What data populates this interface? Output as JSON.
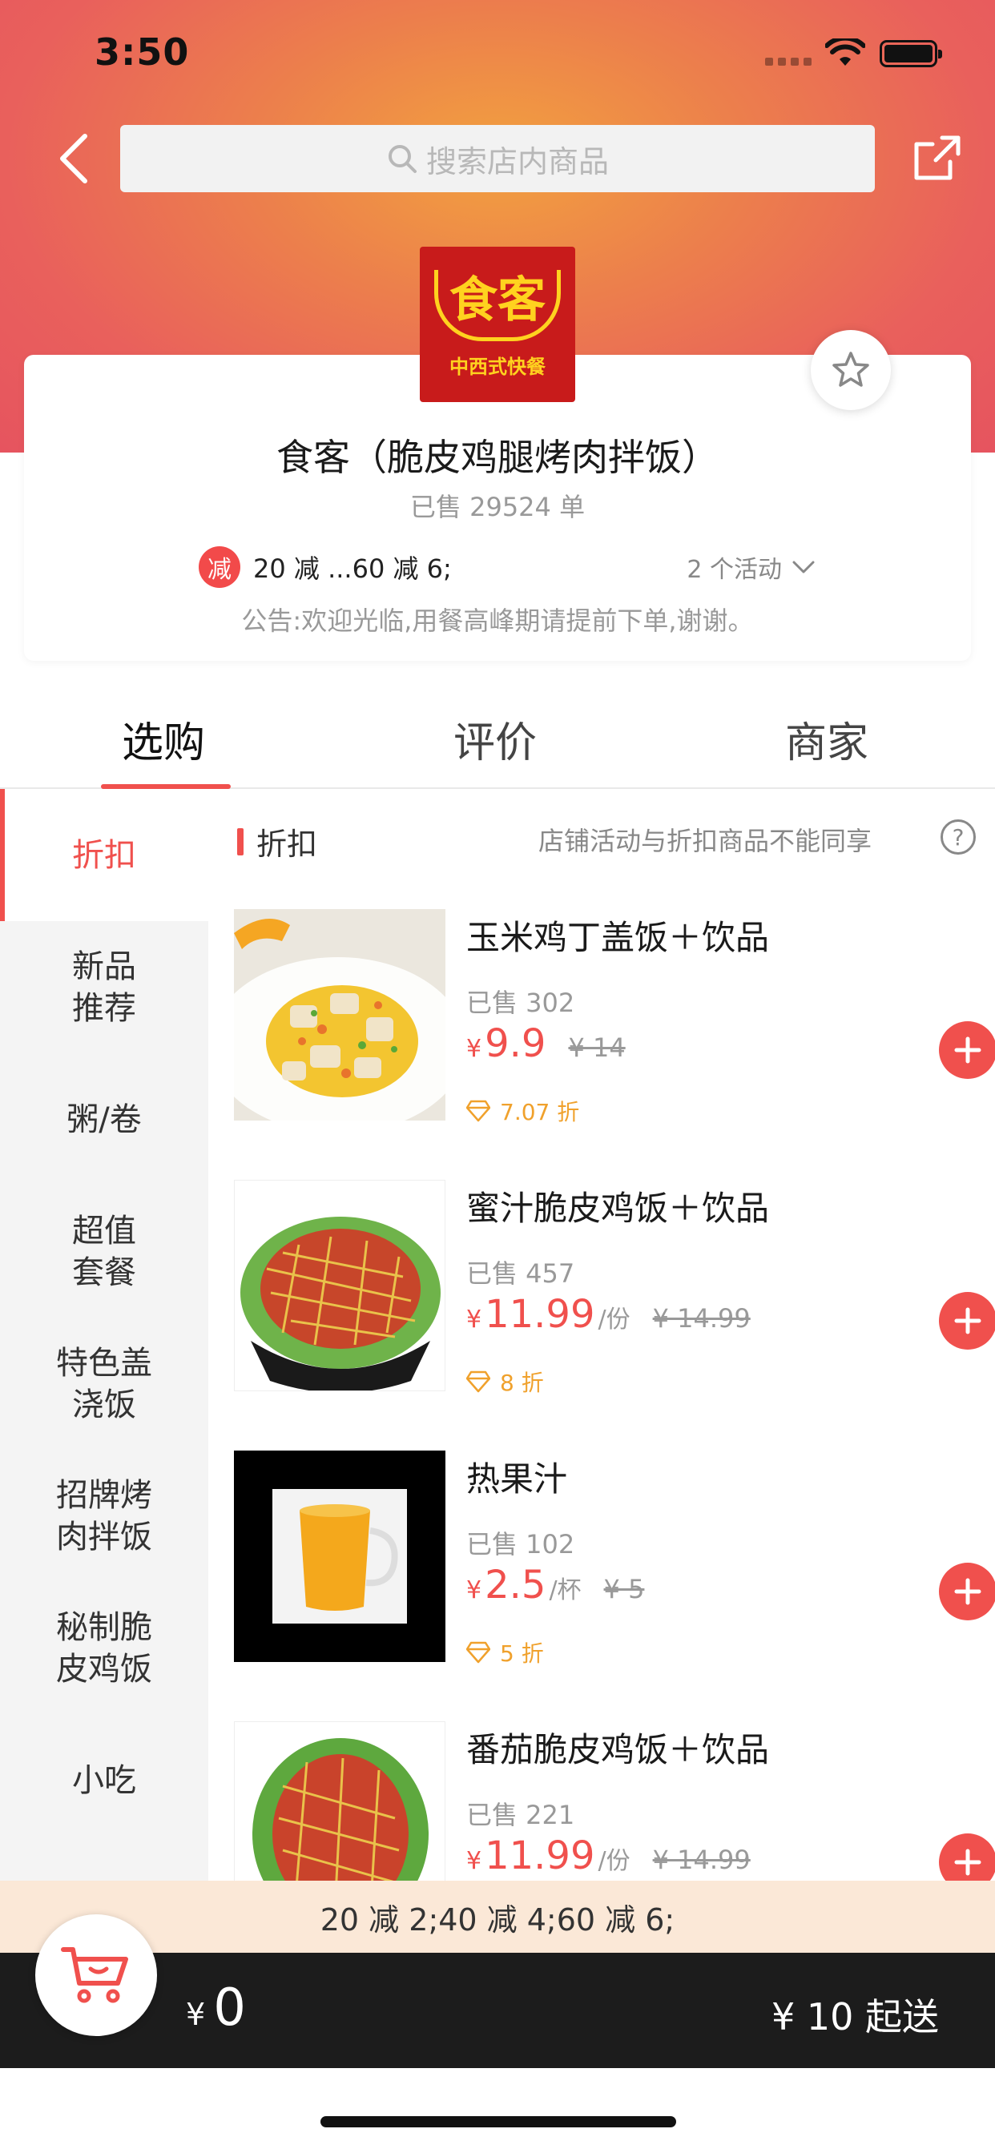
{
  "status_bar": {
    "time": "3:50"
  },
  "nav": {
    "search_placeholder": "搜索店内商品"
  },
  "shop": {
    "logo_text": "食客",
    "logo_sub": "中西式快餐",
    "name": "食客（脆皮鸡腿烤肉拌饭）",
    "sold_total": "已售 29524 单",
    "promo_badge": "减",
    "promo_text": "20 减 ...60 减 6;",
    "promo_count": "2 个活动",
    "notice": "公告:欢迎光临,用餐高峰期请提前下单,谢谢。"
  },
  "tabs": [
    {
      "label": "选购",
      "active": true
    },
    {
      "label": "评价",
      "active": false
    },
    {
      "label": "商家",
      "active": false
    }
  ],
  "sidebar": {
    "items": [
      {
        "label": "折扣",
        "active": true
      },
      {
        "label": "新品\n推荐"
      },
      {
        "label": "粥/卷"
      },
      {
        "label": "超值\n套餐"
      },
      {
        "label": "特色盖\n浇饭"
      },
      {
        "label": "招牌烤\n肉拌饭"
      },
      {
        "label": "秘制脆\n皮鸡饭"
      },
      {
        "label": "小吃"
      }
    ]
  },
  "section": {
    "title": "折扣",
    "note": "店铺活动与折扣商品不能同享",
    "help": "?"
  },
  "products": [
    {
      "name": "玉米鸡丁盖饭＋饮品",
      "sold": "已售 302",
      "currency": "¥",
      "price": "9.9",
      "unit": "",
      "original": "¥ 14",
      "discount": "7.07 折"
    },
    {
      "name": "蜜汁脆皮鸡饭＋饮品",
      "sold": "已售 457",
      "currency": "¥",
      "price": "11.99",
      "unit": "/份",
      "original": "¥ 14.99",
      "discount": "8 折"
    },
    {
      "name": "热果汁",
      "sold": "已售 102",
      "currency": "¥",
      "price": "2.5",
      "unit": "/杯",
      "original": "¥ 5",
      "discount": "5 折"
    },
    {
      "name": "番茄脆皮鸡饭＋饮品",
      "sold": "已售 221",
      "currency": "¥",
      "price": "11.99",
      "unit": "/份",
      "original": "¥ 14.99",
      "discount": ""
    }
  ],
  "promo_strip": "20 减 2;40 减 4;60 减 6;",
  "cart": {
    "currency": "¥",
    "total": "0",
    "min_order": "¥ 10 起送"
  },
  "colors": {
    "accent": "#f0504d",
    "discount": "#f0a12c",
    "cart_bar": "#1c1c1c",
    "promo_strip": "#fbe8d7"
  }
}
